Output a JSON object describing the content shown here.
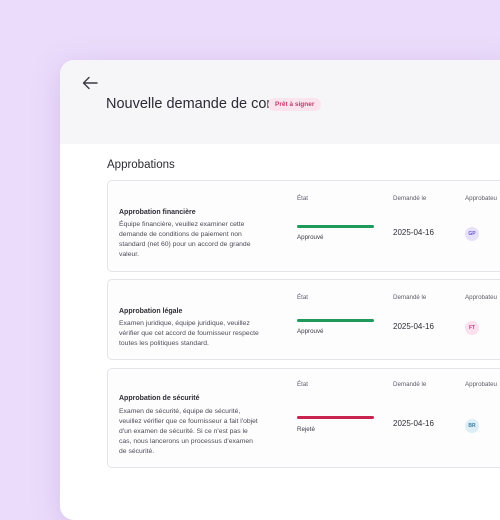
{
  "header": {
    "back_icon": "arrow-left-icon",
    "title": "Nouvelle demande de contrat",
    "badge": "Prêt à signer"
  },
  "section_title": "Approbations",
  "columns": {
    "state": "État",
    "requested": "Demandé le",
    "approver": "Approbateu"
  },
  "approvals": [
    {
      "name": "Approbation financière",
      "description": "Équipe financière, veuillez examiner cette demande de conditions de paiement non standard (net 60) pour un accord de grande valeur.",
      "status": "Approuvé",
      "status_color": "#1f9a5b",
      "progress": 1.0,
      "date": "2025-04-16",
      "approver_initials": "GP",
      "avatar_bg": "#e6e0fb",
      "avatar_fg": "#6a56c8"
    },
    {
      "name": "Approbation légale",
      "description": "Examen juridique, équipe juridique, veuillez vérifier que cet accord de fournisseur respecte toutes les politiques standard.",
      "status": "Approuvé",
      "status_color": "#1f9a5b",
      "progress": 1.0,
      "date": "2025-04-16",
      "approver_initials": "FT",
      "avatar_bg": "#fbe0ee",
      "avatar_fg": "#c23b7f"
    },
    {
      "name": "Approbation de sécurité",
      "description": "Examen de sécurité, équipe de sécurité, veuillez vérifier que ce fournisseur a fait l'objet d'un examen de sécurité. Si ce n'est pas le cas, nous lancerons un processus d'examen de sécurité.",
      "status": "Rejeté",
      "status_color": "#c8244f",
      "progress": 1.0,
      "date": "2025-04-16",
      "approver_initials": "BR",
      "avatar_bg": "#ddeef6",
      "avatar_fg": "#3f7fa6"
    }
  ]
}
